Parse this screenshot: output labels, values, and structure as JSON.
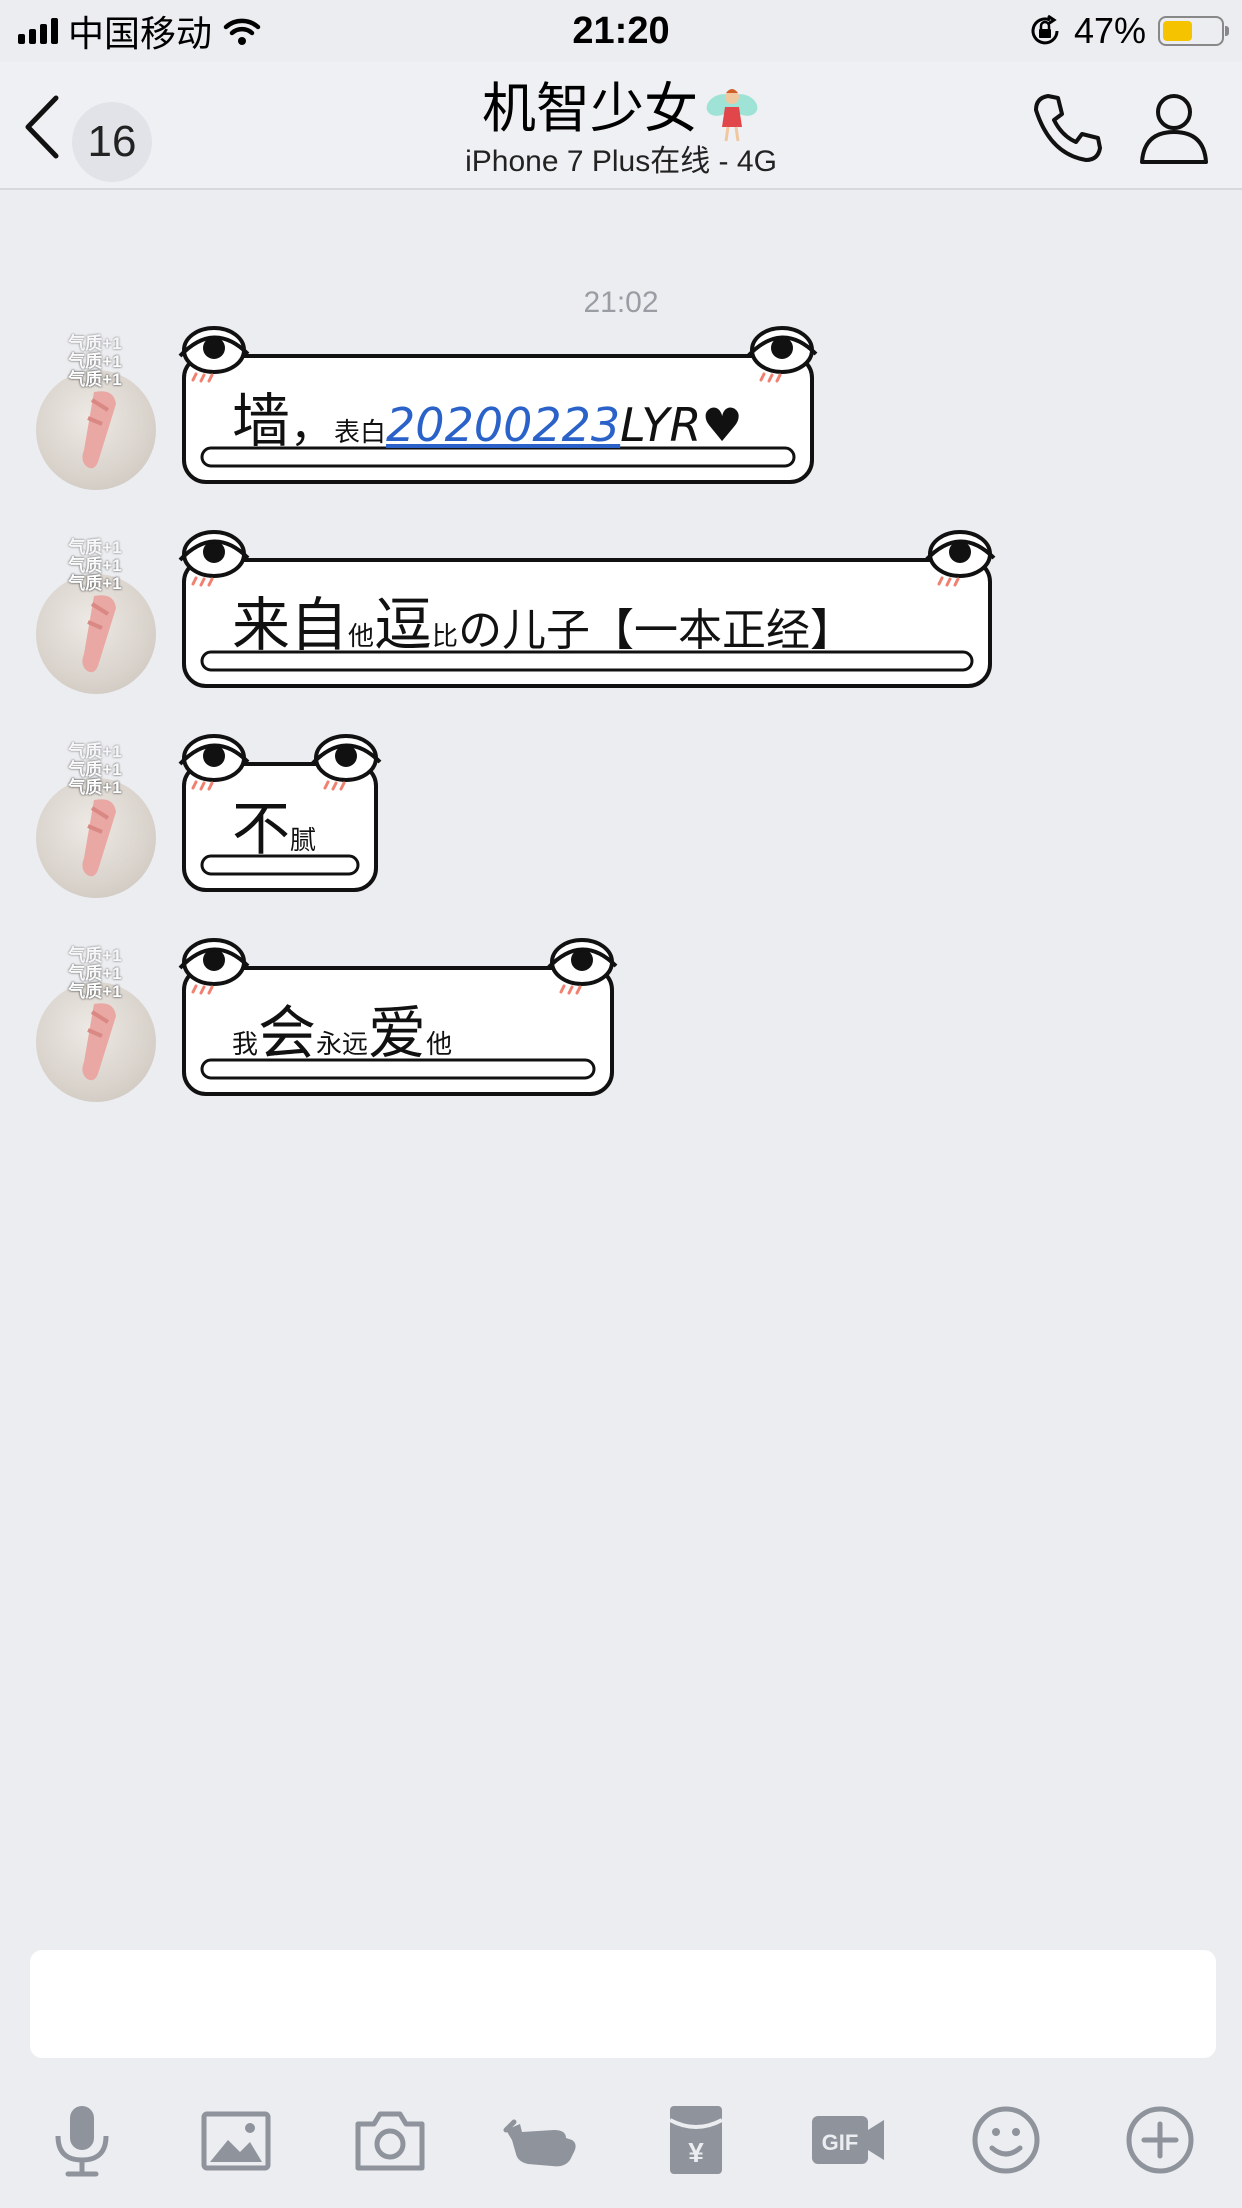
{
  "status_bar": {
    "carrier": "中国移动",
    "time": "21:20",
    "battery_percent": "47%",
    "battery_level": 0.47,
    "icons": [
      "signal-icon",
      "wifi-icon",
      "rotation-lock-icon",
      "battery-icon"
    ]
  },
  "nav": {
    "back_count": "16",
    "title": "机智少女",
    "subtitle": "iPhone 7 Plus在线 - 4G",
    "icons": [
      "back-icon",
      "fairy-emoji-icon",
      "phone-icon",
      "profile-icon"
    ]
  },
  "chat": {
    "timestamp": "21:02",
    "avatar_tag": "气质+1",
    "messages": [
      {
        "segments": [
          {
            "text": "墙",
            "size": "big"
          },
          {
            "text": "，",
            "size": "mid"
          },
          {
            "text": "表白",
            "size": "small"
          },
          {
            "text": "20200223",
            "size": "link"
          },
          {
            "text": "LYR♥",
            "size": "italic"
          }
        ]
      },
      {
        "segments": [
          {
            "text": "来自",
            "size": "big"
          },
          {
            "text": "他",
            "size": "small"
          },
          {
            "text": "逗",
            "size": "big"
          },
          {
            "text": "比",
            "size": "small"
          },
          {
            "text": "の儿子【一本正经】",
            "size": "mid"
          }
        ]
      },
      {
        "segments": [
          {
            "text": "不",
            "size": "big"
          },
          {
            "text": "腻",
            "size": "small"
          }
        ]
      },
      {
        "segments": [
          {
            "text": "我",
            "size": "small"
          },
          {
            "text": "会",
            "size": "big"
          },
          {
            "text": "永远",
            "size": "small"
          },
          {
            "text": "爱",
            "size": "big"
          },
          {
            "text": "他",
            "size": "small"
          }
        ]
      }
    ]
  },
  "input": {
    "placeholder": ""
  },
  "toolbar": {
    "icons": [
      "microphone-icon",
      "image-icon",
      "camera-icon",
      "poke-icon",
      "red-packet-icon",
      "gif-icon",
      "emoji-icon",
      "plus-icon"
    ],
    "gif_label": "GIF",
    "yen_label": "¥"
  },
  "colors": {
    "background": "#ebedf0",
    "link": "#2a62c9",
    "battery": "#f5c300"
  }
}
